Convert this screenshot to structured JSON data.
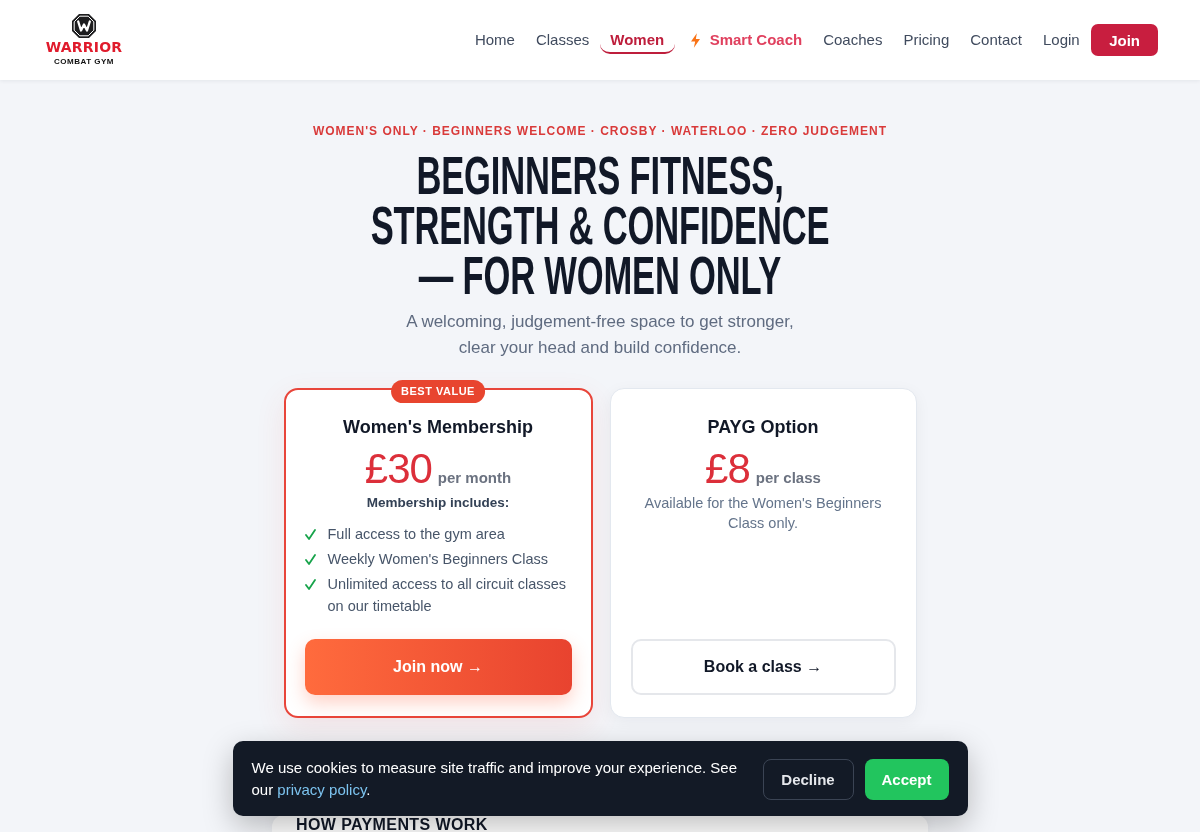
{
  "header": {
    "logo": {
      "name": "WARRIOR",
      "tagline": "COMBAT GYM"
    },
    "nav": [
      {
        "label": "Home",
        "kind": "link",
        "selected": false
      },
      {
        "label": "Classes",
        "kind": "link",
        "selected": false
      },
      {
        "label": "Women",
        "kind": "link",
        "selected": true
      },
      {
        "label": "Smart Coach",
        "kind": "featured",
        "selected": false
      },
      {
        "label": "Coaches",
        "kind": "link",
        "selected": false
      },
      {
        "label": "Pricing",
        "kind": "link",
        "selected": false
      },
      {
        "label": "Contact",
        "kind": "link",
        "selected": false
      },
      {
        "label": "Login",
        "kind": "link",
        "selected": false
      }
    ],
    "join_button": "Join"
  },
  "hero": {
    "eyebrow": "WOMEN'S ONLY · BEGINNERS WELCOME · CROSBY · WATERLOO · ZERO JUDGEMENT",
    "title": "BEGINNERS FITNESS, STRENGTH & CONFIDENCE — FOR WOMEN ONLY",
    "subtitle": "A welcoming, judgement-free space to get stronger, clear your head and build confidence."
  },
  "plans": [
    {
      "featured": true,
      "badge": "BEST VALUE",
      "name": "Women's Membership",
      "price": "£30",
      "period": "per month",
      "includes_title": "Membership includes:",
      "features": [
        "Full access to the gym area",
        "Weekly Women's Beginners Class",
        "Unlimited access to all circuit classes on our timetable"
      ],
      "button": "Join now →"
    },
    {
      "featured": false,
      "name": "PAYG Option",
      "price": "£8",
      "period": "per class",
      "description": "Available for the Women's Beginners Class only.",
      "button": "Book a class →"
    }
  ],
  "payments": {
    "title": "HOW PAYMENTS WORK"
  },
  "cookie_banner": {
    "text": "We use cookies to measure site traffic and improve your experience. See our",
    "link": "privacy policy",
    "text_end": ".",
    "buttons": [
      {
        "label": "Decline",
        "kind": "secondary"
      },
      {
        "label": "Accept",
        "kind": "primary"
      }
    ]
  }
}
